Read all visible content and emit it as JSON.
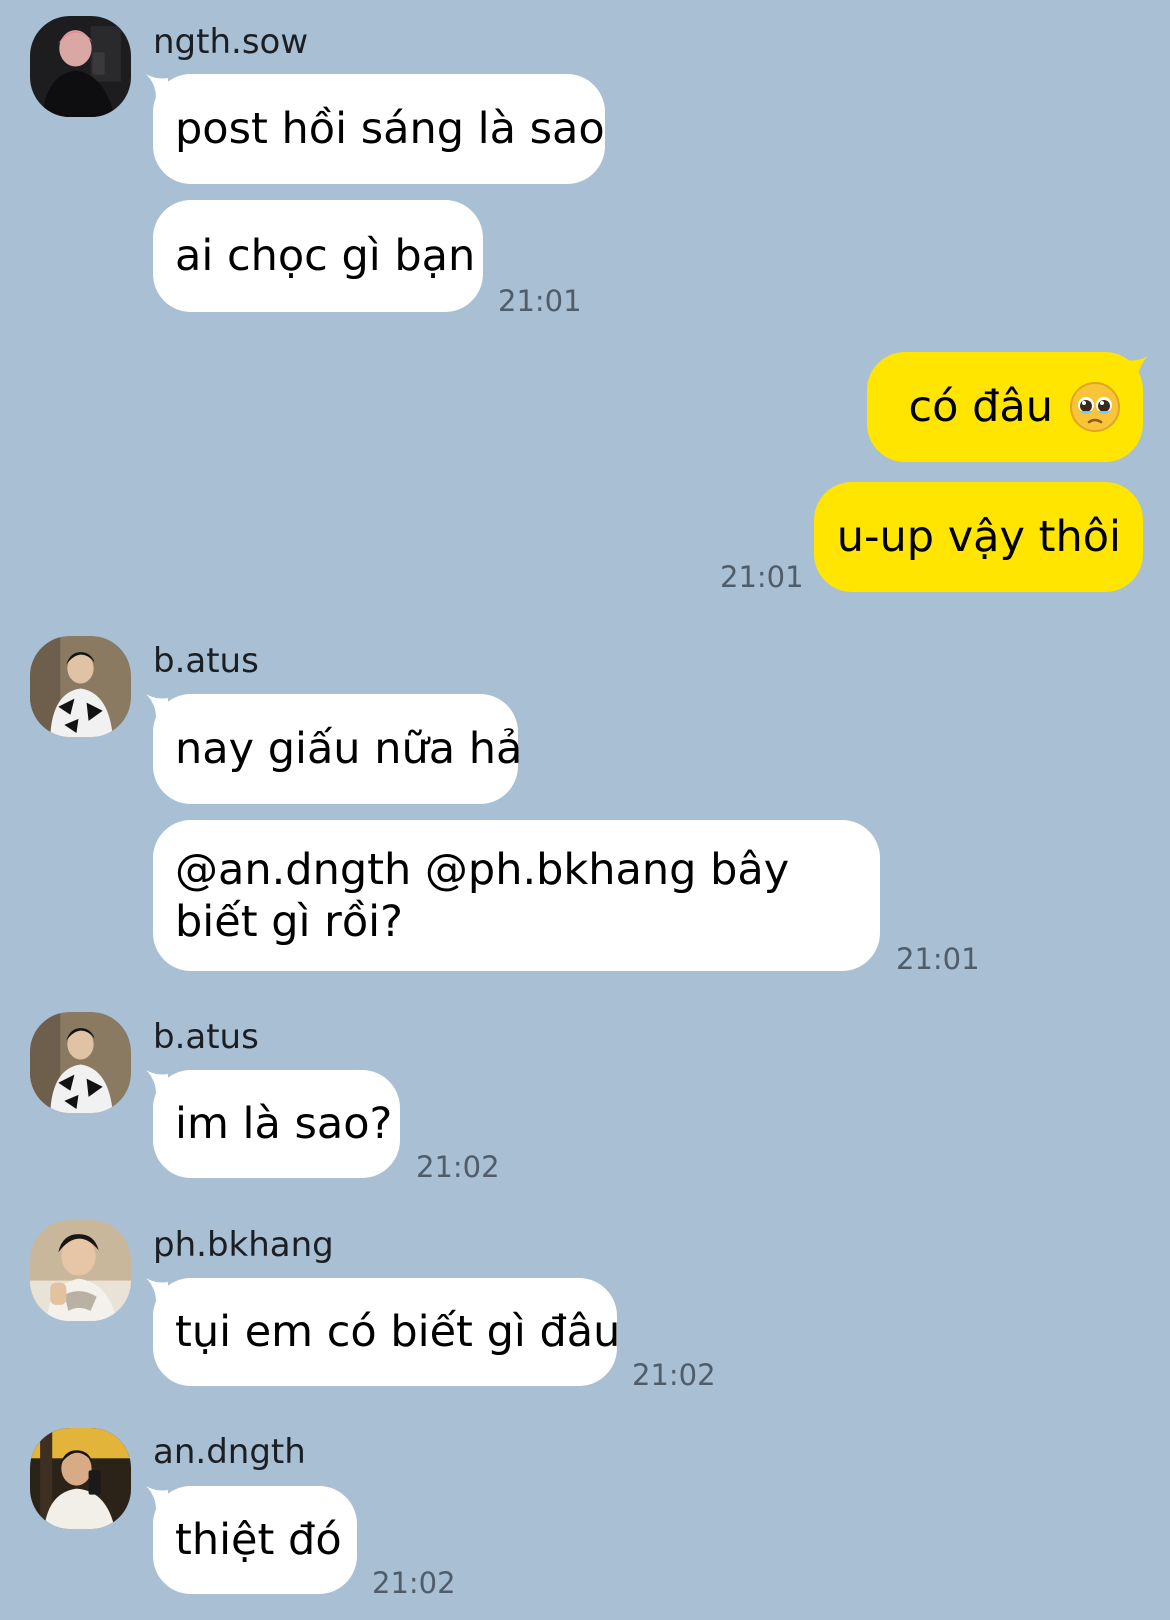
{
  "messages": [
    {
      "sender": "ngth.sow",
      "avatar": "ngth-sow-avatar",
      "lines": [
        "post hồi sáng là sao",
        "ai chọc gì bạn"
      ],
      "time": "21:01"
    },
    {
      "sender": "me",
      "lines": [
        "có đâu",
        "u-up vậy thôi"
      ],
      "emoji": "pleading-face-icon",
      "time": "21:01"
    },
    {
      "sender": "b.atus",
      "avatar": "b-atus-avatar",
      "lines": [
        "nay giấu nữa hả",
        "@an.dngth @ph.bkhang bây biết gì rồi?"
      ],
      "time": "21:01"
    },
    {
      "sender": "b.atus",
      "avatar": "b-atus-avatar",
      "lines": [
        "im là sao?"
      ],
      "time": "21:02"
    },
    {
      "sender": "ph.bkhang",
      "avatar": "ph-bkhang-avatar",
      "lines": [
        "tụi em có biết gì đâu"
      ],
      "time": "21:02"
    },
    {
      "sender": "an.dngth",
      "avatar": "an-dngth-avatar",
      "lines": [
        "thiệt đó"
      ],
      "time": "21:02"
    }
  ],
  "colors": {
    "background": "#a9bfd3",
    "incoming_bubble": "#ffffff",
    "outgoing_bubble": "#ffe500",
    "timestamp": "#4f5d6b"
  }
}
